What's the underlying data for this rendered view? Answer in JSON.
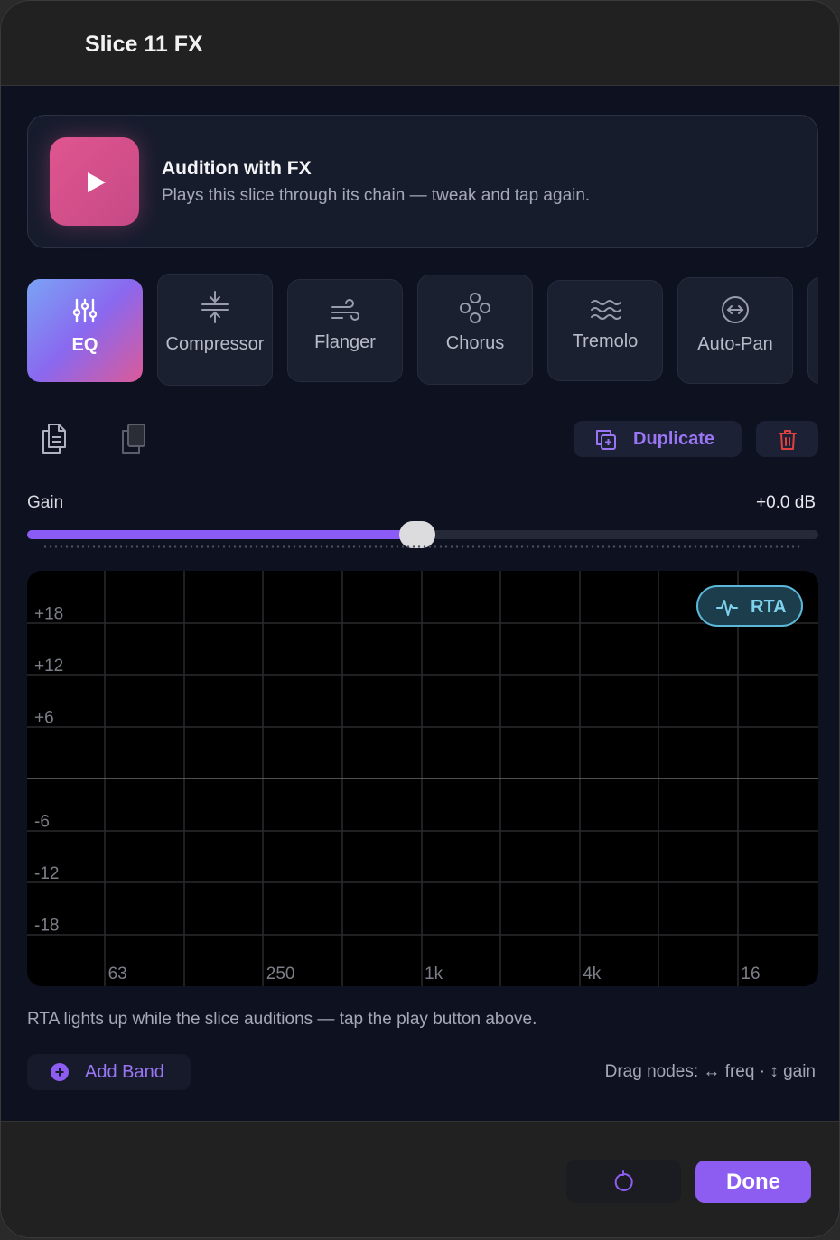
{
  "header": {
    "title": "Slice 11 FX"
  },
  "audition": {
    "title": "Audition with FX",
    "subtitle": "Plays this slice through its chain — tweak and tap again."
  },
  "tabs": [
    {
      "label": "EQ",
      "icon": "sliders-icon",
      "active": true
    },
    {
      "label": "Compressor",
      "icon": "compress-icon"
    },
    {
      "label": "Flanger",
      "icon": "wind-icon"
    },
    {
      "label": "Chorus",
      "icon": "chorus-icon"
    },
    {
      "label": "Tremolo",
      "icon": "waves-icon"
    },
    {
      "label": "Auto-Pan",
      "icon": "auto-pan-icon"
    }
  ],
  "toolbar": {
    "duplicate_label": "Duplicate"
  },
  "gain": {
    "label": "Gain",
    "value": "+0.0 dB",
    "level": 0.5
  },
  "eq": {
    "db_labels": [
      "+18",
      "+12",
      "+6",
      "-6",
      "-12",
      "-18"
    ],
    "freq_labels": [
      "63",
      "250",
      "1k",
      "4k",
      "16"
    ],
    "rta_label": "RTA"
  },
  "hint": "RTA lights up while the slice auditions — tap the play button above.",
  "add_band_label": "Add Band",
  "drag_hint": "Drag nodes: ↔ freq · ↕ gain",
  "footer": {
    "done_label": "Done"
  },
  "colors": {
    "accent": "#8c5df0",
    "play": "#d6508c",
    "rta": "#5bb8d8"
  }
}
